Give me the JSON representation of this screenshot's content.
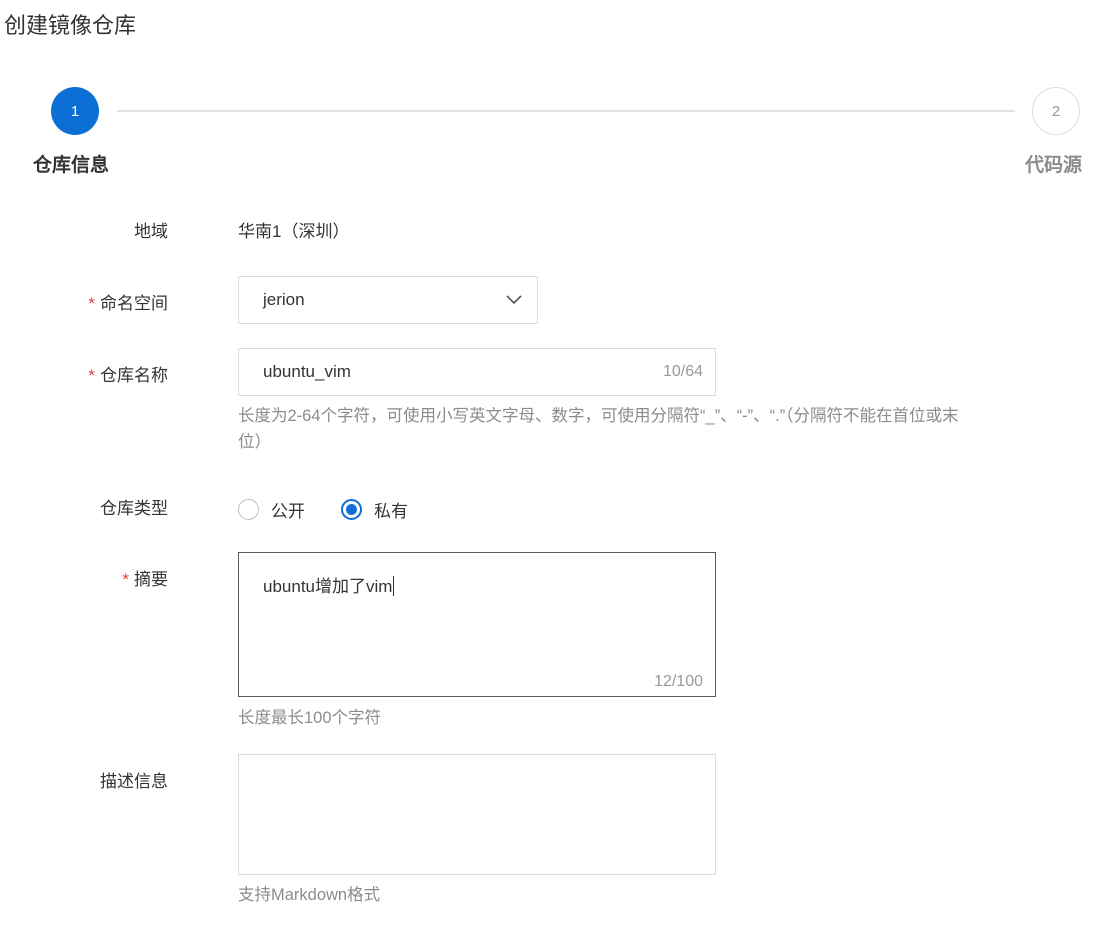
{
  "page": {
    "title": "创建镜像仓库"
  },
  "steps": [
    {
      "number": "1",
      "label": "仓库信息",
      "state": "active"
    },
    {
      "number": "2",
      "label": "代码源",
      "state": "pending"
    }
  ],
  "form": {
    "region": {
      "label": "地域",
      "value": "华南1（深圳）"
    },
    "namespace": {
      "label": "命名空间",
      "required_mark": "*",
      "value": "jerion",
      "icon": "chevron-down-icon"
    },
    "repo_name": {
      "label": "仓库名称",
      "required_mark": "*",
      "value": "ubuntu_vim",
      "counter": "10/64",
      "hint_line1": "长度为2-64个字符，可使用小写英文字母、数字，可使用分隔符“_”、“-”、“.”（分隔符不能在首位或末",
      "hint_line2": "位）"
    },
    "repo_type": {
      "label": "仓库类型",
      "options": [
        {
          "label": "公开",
          "checked": false
        },
        {
          "label": "私有",
          "checked": true
        }
      ]
    },
    "summary": {
      "label": "摘要",
      "required_mark": "*",
      "value": "ubuntu增加了vim",
      "counter": "12/100",
      "hint": "长度最长100个字符"
    },
    "description": {
      "label": "描述信息",
      "value": "",
      "hint": "支持Markdown格式"
    }
  },
  "colors": {
    "accent": "#0b6fd6",
    "required": "#e0403a",
    "hint": "#8c8c8c"
  }
}
